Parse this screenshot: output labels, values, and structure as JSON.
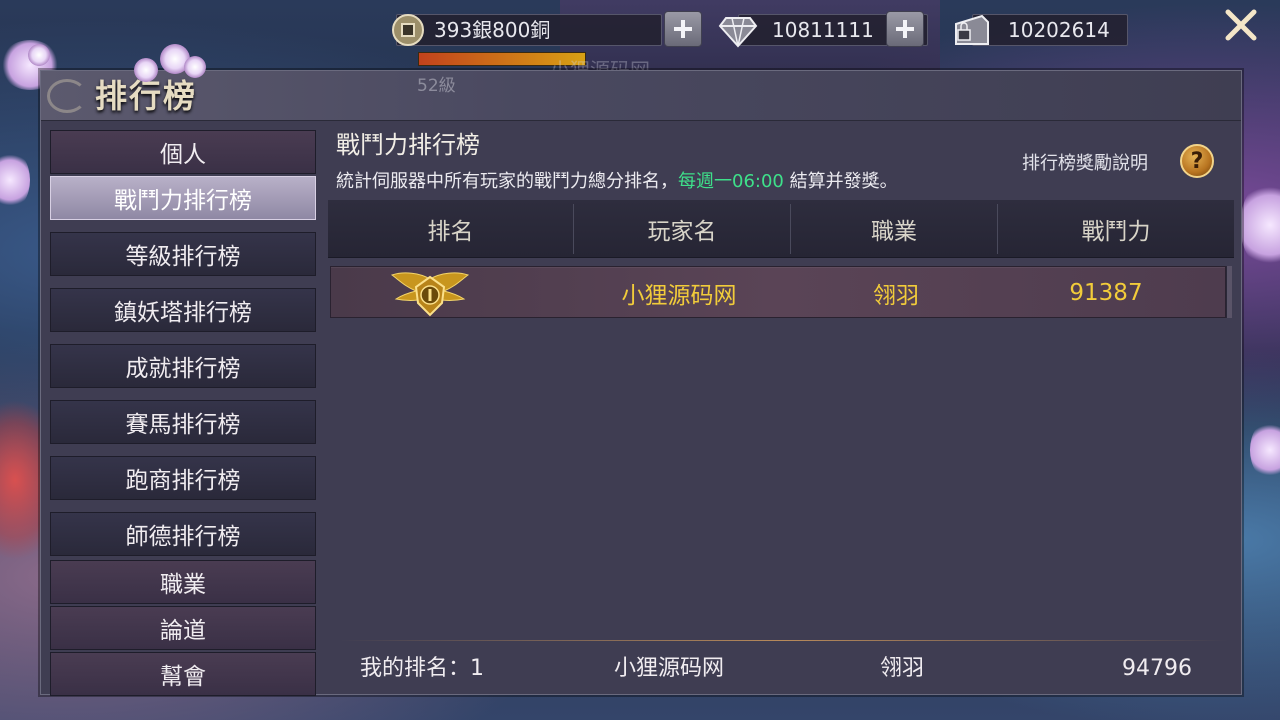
{
  "topbar": {
    "silver": "393銀800銅",
    "diamond": "10811111",
    "bound_gold": "10202614",
    "icons": {
      "silver": "coin-icon",
      "diamond": "diamond-icon",
      "bound_gold": "locked-chest-icon",
      "close": "close-icon"
    }
  },
  "player_strip": {
    "level": "52級"
  },
  "panel": {
    "title": "排行榜"
  },
  "sidebar": {
    "items": [
      {
        "label": "個人",
        "kind": "category"
      },
      {
        "label": "戰鬥力排行榜",
        "kind": "tab",
        "active": true
      },
      {
        "label": "等級排行榜",
        "kind": "tab"
      },
      {
        "label": "鎮妖塔排行榜",
        "kind": "tab"
      },
      {
        "label": "成就排行榜",
        "kind": "tab"
      },
      {
        "label": "賽馬排行榜",
        "kind": "tab"
      },
      {
        "label": "跑商排行榜",
        "kind": "tab"
      },
      {
        "label": "師德排行榜",
        "kind": "tab"
      },
      {
        "label": "職業",
        "kind": "category"
      },
      {
        "label": "論道",
        "kind": "category"
      },
      {
        "label": "幫會",
        "kind": "category"
      }
    ]
  },
  "content": {
    "title": "戰鬥力排行榜",
    "desc_prefix": "統計伺服器中所有玩家的戰鬥力總分排名，",
    "desc_highlight": "每週一06:00",
    "desc_suffix": "結算并發獎。",
    "reward_link": "排行榜獎勵說明",
    "help_label": "?"
  },
  "table": {
    "columns": [
      "排名",
      "玩家名",
      "職業",
      "戰鬥力"
    ],
    "rows": [
      {
        "rank_icon": "gold-rank-1-emblem-icon",
        "name": "小狸源码网",
        "class": "翎羽",
        "power": "91387"
      }
    ]
  },
  "my_rank": {
    "label": "我的排名：1",
    "name": "小狸源码网",
    "class": "翎羽",
    "power": "94796"
  },
  "colors": {
    "highlight_green": "#3ee08a",
    "row_gold": "#f2cc3a",
    "accent_gold": "#e6b456"
  }
}
